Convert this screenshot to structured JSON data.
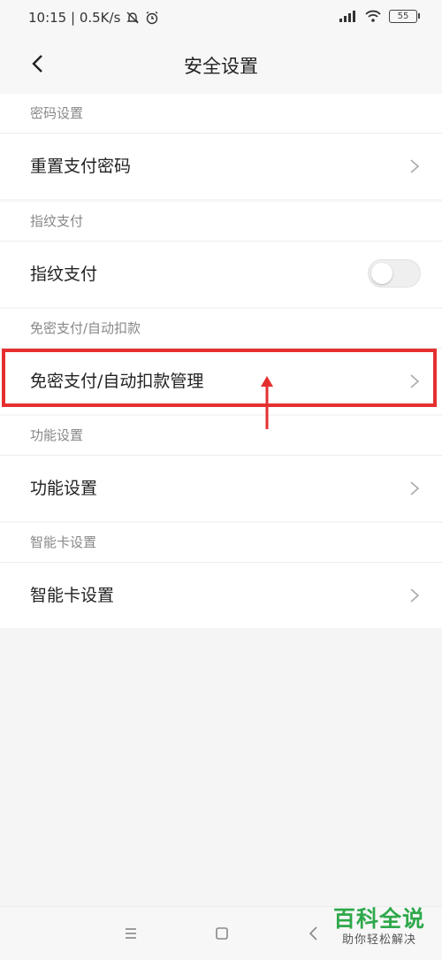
{
  "status_bar": {
    "time_speed": "10:15 | 0.5K/s",
    "battery": "55"
  },
  "header": {
    "title": "安全设置"
  },
  "sections": [
    {
      "title": "密码设置",
      "row": "重置支付密码"
    },
    {
      "title": "指纹支付",
      "row": "指纹支付",
      "toggle_on": false
    },
    {
      "title": "免密支付/自动扣款",
      "row": "免密支付/自动扣款管理"
    },
    {
      "title": "功能设置",
      "row": "功能设置"
    },
    {
      "title": "智能卡设置",
      "row": "智能卡设置"
    }
  ],
  "watermark": {
    "main": "百科全说",
    "sub": "助你轻松解决"
  },
  "colors": {
    "highlight": "#e52f2f",
    "watermark": "#2ea84a"
  }
}
